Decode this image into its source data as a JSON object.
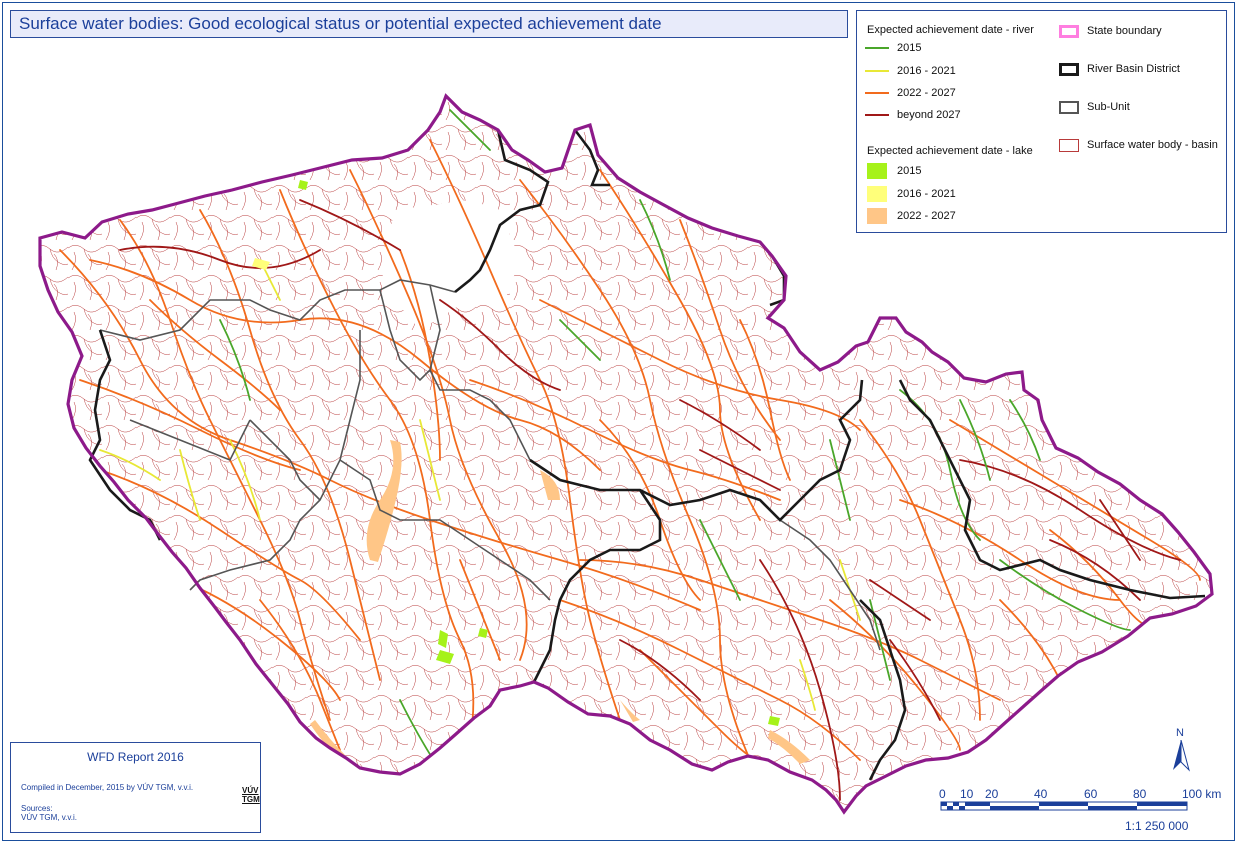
{
  "title": "Surface water bodies: Good ecological status or potential expected achievement date",
  "colors": {
    "river_2015": "#4aa62a",
    "river_2016_2021": "#e8e836",
    "river_2022_2027": "#f26b1d",
    "river_beyond_2027": "#a01818",
    "lake_2015": "#a6f21a",
    "lake_2016_2021": "#ffff7a",
    "lake_2022_2027": "#ffc687",
    "state_boundary": "#8d1a8a",
    "state_boundary_legend": "#ff7ee0",
    "river_basin_district": "#1a1a1a",
    "sub_unit": "#555555",
    "water_body_basin": "#b83a3a"
  },
  "legend": {
    "river_heading": "Expected achievement date - river",
    "river_items": [
      "2015",
      "2016 - 2021",
      "2022 - 2027",
      "beyond 2027"
    ],
    "lake_heading": "Expected achievement date - lake",
    "lake_items": [
      "2015",
      "2016 - 2021",
      "2022 - 2027"
    ],
    "boundary_items": [
      "State boundary",
      "River Basin District",
      "Sub-Unit",
      "Surface water body - basin"
    ]
  },
  "info": {
    "report": "WFD Report 2016",
    "compiled": "Compiled in December, 2015 by VÚV TGM, v.v.i.",
    "sources_label": "Sources:",
    "sources_value": "VÚV TGM, v.v.i.",
    "logo_top": "VÚV",
    "logo_bottom": "TGM"
  },
  "scale": {
    "ticks": [
      "0",
      "10",
      "20",
      "40",
      "60",
      "80",
      "100 km"
    ],
    "ratio": "1:1 250 000"
  },
  "north_label": "N"
}
